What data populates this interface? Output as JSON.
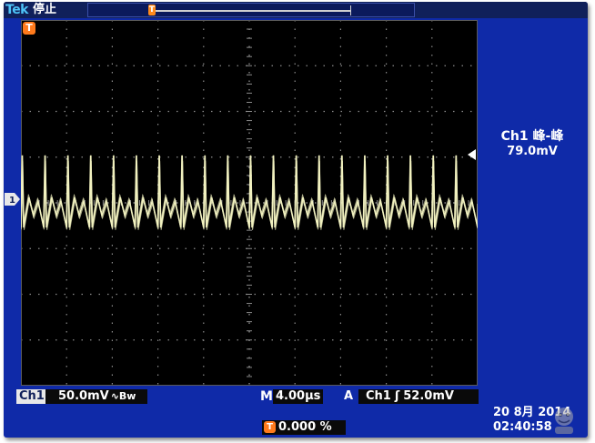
{
  "header": {
    "brand": "Tek",
    "run_state": "停止",
    "trigger_position_marker": "T"
  },
  "graticule": {
    "trigger_marker": "T",
    "ground_marker": "1"
  },
  "measurement": {
    "label": "Ch1 峰-峰",
    "value": "79.0mV"
  },
  "status": {
    "channel": "Ch1",
    "volts_per_div": "50.0mV",
    "bandwidth_symbol": "∿Bw",
    "timebase_prefix": "M",
    "timebase": "4.00µs",
    "trigger_mode": "A",
    "trigger_source": "Ch1",
    "trigger_slope": "ʃ",
    "trigger_level": "52.0mV",
    "trigger_offset_icon": "T",
    "trigger_offset": "0.000 %",
    "date": "20 8月  2014",
    "time": "02:40:58"
  },
  "colors": {
    "bezel": "#0f2aa8",
    "trace": "#f2f2c0",
    "accent": "#ff7a1c",
    "grid": "#8a8a8a"
  },
  "chart_data": {
    "type": "line",
    "xlabel": "",
    "ylabel": "",
    "divisions": {
      "x": 10,
      "y": 8
    },
    "x_units_per_div": "4.00µs",
    "y_units_per_div": "50.0mV",
    "xlim": [
      0,
      40
    ],
    "ylim": [
      -200,
      200
    ],
    "series": [
      {
        "color": "#f2f2c0",
        "period_us": 2.0,
        "cycles": 20,
        "peak_mv": 52,
        "trough_mv": -27
      }
    ]
  }
}
